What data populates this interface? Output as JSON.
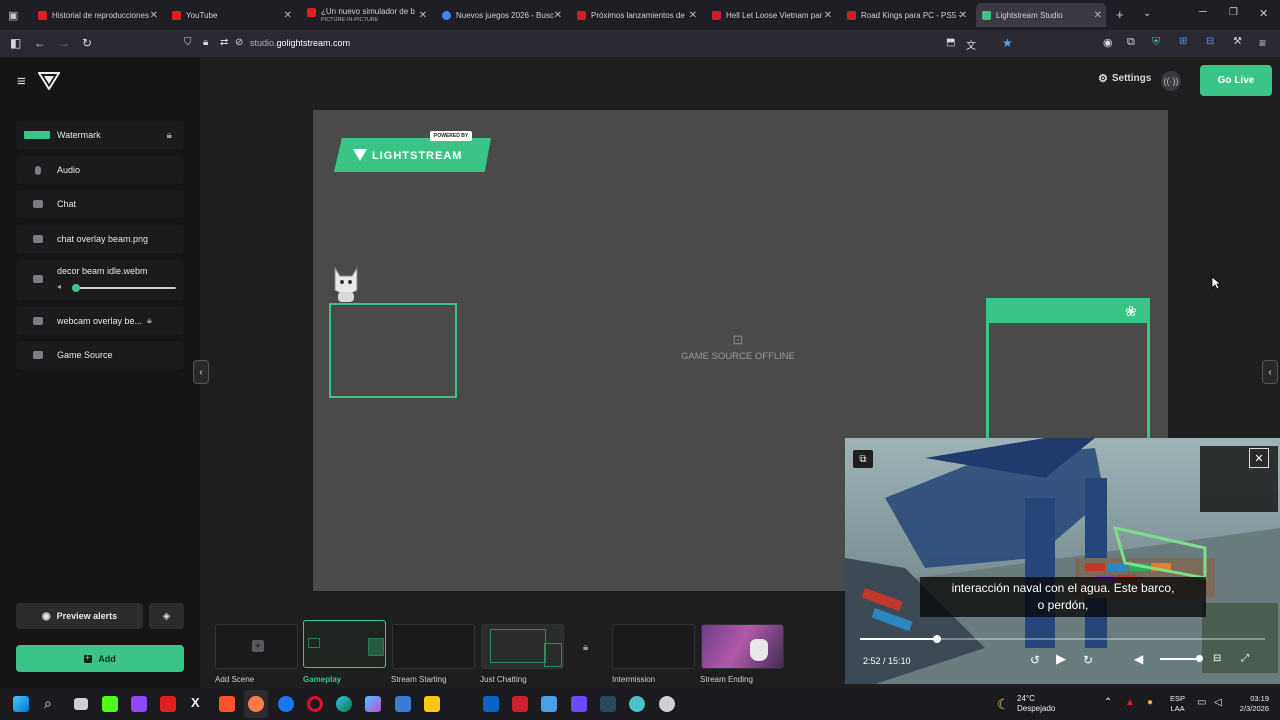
{
  "browser": {
    "tabs": [
      {
        "title": "Historial de reproducciones",
        "color": "#e02020"
      },
      {
        "title": "YouTube",
        "color": "#e02020"
      },
      {
        "title": "¿Un nuevo simulador de b",
        "sub": "PICTURE-IN-PICTURE",
        "color": "#e02020"
      },
      {
        "title": "Nuevos juegos 2026 - Busc",
        "color": "#4285f4"
      },
      {
        "title": "Próximos lanzamientos de",
        "color": "#d01c2a"
      },
      {
        "title": "Hell Let Loose Vietnam par",
        "color": "#d01c2a"
      },
      {
        "title": "Road Kings para PC - PS5 -",
        "color": "#d01c2a"
      },
      {
        "title": "Lightstream Studio",
        "color": "#3bc488"
      }
    ],
    "url_prefix": "studio.",
    "url_domain": "golightstream.com"
  },
  "header": {
    "settings_label": "Settings",
    "go_live_label": "Go Live"
  },
  "sidebar": {
    "items": [
      {
        "label": "Watermark",
        "locked": true
      },
      {
        "label": "Audio"
      },
      {
        "label": "Chat"
      },
      {
        "label": "chat overlay beam.png"
      },
      {
        "label": "decor beam idle.webm"
      },
      {
        "label": "webcam overlay be...",
        "locked": true
      },
      {
        "label": "Game Source"
      }
    ],
    "decor_volume_fraction": 0.0,
    "preview_alerts_label": "Preview alerts",
    "add_label": "Add"
  },
  "canvas": {
    "watermark_badge": "POWERED BY",
    "watermark_text": "LIGHTSTREAM",
    "game_source_offline": "GAME SOURCE OFFLINE"
  },
  "scenes": [
    {
      "label": "Add Scene"
    },
    {
      "label": "Gameplay",
      "active": true
    },
    {
      "label": "Stream Starting"
    },
    {
      "label": "Just Chatting"
    },
    {
      "label": "Intermission"
    },
    {
      "label": "Stream Ending"
    }
  ],
  "pip": {
    "caption_line1": "interacción naval con el agua. Este barco,",
    "caption_line2": "o perdón,",
    "time": "2:52 / 15:10",
    "progress_fraction": 0.19
  },
  "taskbar": {
    "weather_temp": "24°C",
    "weather_desc": "Despejado",
    "lang1": "ESP",
    "lang2": "LAA",
    "clock_time": "03:19",
    "clock_date": "2/3/2026"
  },
  "colors": {
    "accent": "#3bc488",
    "canvas_bg": "#4a4a4b"
  }
}
